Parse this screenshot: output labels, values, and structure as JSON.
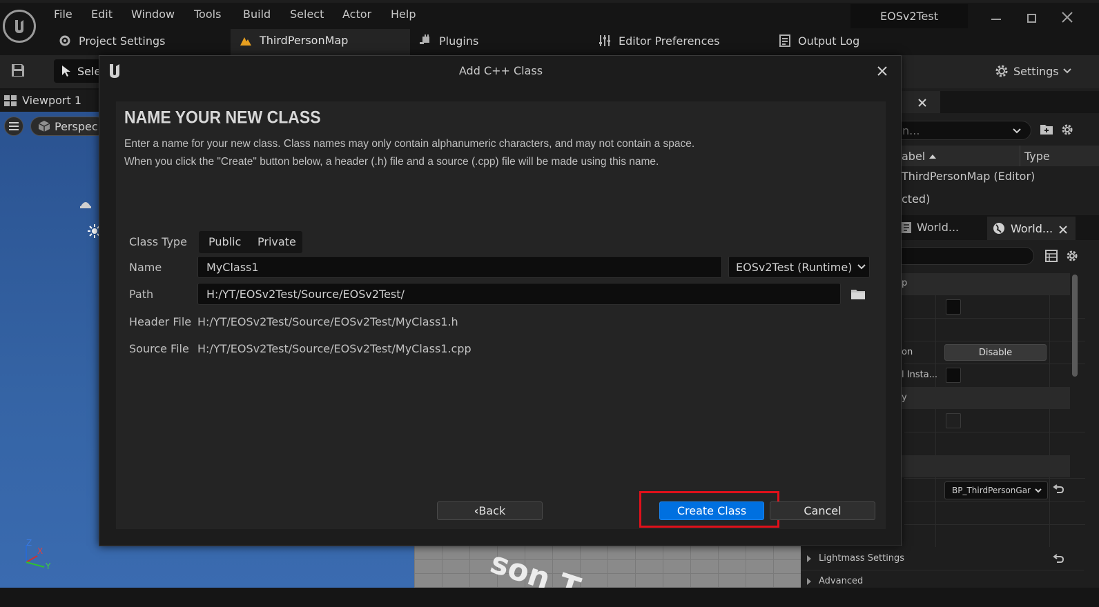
{
  "menubar": {
    "items": [
      "File",
      "Edit",
      "Window",
      "Tools",
      "Build",
      "Select",
      "Actor",
      "Help"
    ],
    "project_name": "EOSv2Test"
  },
  "tabs": {
    "project_settings": "Project Settings",
    "third_person_map": "ThirdPersonMap",
    "plugins": "Plugins",
    "editor_preferences": "Editor Preferences",
    "output_log": "Output Log"
  },
  "toolbar": {
    "select_label": "Sele",
    "settings_label": "Settings"
  },
  "viewport": {
    "tab_label": "Viewport 1",
    "perspective_label": "Perspec",
    "floor_text": "son T",
    "axis_x": "X",
    "axis_y": "Y",
    "axis_z": "Z"
  },
  "outliner": {
    "search_placeholder": "n...",
    "col_label": "abel",
    "col_type": "Type",
    "row1": "ThirdPersonMap (Editor)",
    "row2": "cted)"
  },
  "details": {
    "tab1": "World...",
    "tab2": "World...",
    "row_p": "p",
    "row_on": "on",
    "disable_btn": "Disable",
    "row_insta": "l Insta...",
    "row_y": "y",
    "gamemode_value": "BP_ThirdPersonGar",
    "lightmass": "Lightmass Settings",
    "advanced": "Advanced"
  },
  "dialog": {
    "title": "Add C++ Class",
    "heading": "NAME YOUR NEW CLASS",
    "desc_line1": "Enter a name for your new class. Class names may only contain alphanumeric characters, and may not contain a space.",
    "desc_line2": "When you click the \"Create\" button below, a header (.h) file and a source (.cpp) file will be made using this name.",
    "class_type_label": "Class Type",
    "public_label": "Public",
    "private_label": "Private",
    "name_label": "Name",
    "name_value": "MyClass1",
    "module_value": "EOSv2Test (Runtime)",
    "path_label": "Path",
    "path_value": "H:/YT/EOSv2Test/Source/EOSv2Test/",
    "header_label": "Header File",
    "header_value": "H:/YT/EOSv2Test/Source/EOSv2Test/MyClass1.h",
    "source_label": "Source File",
    "source_value": "H:/YT/EOSv2Test/Source/EOSv2Test/MyClass1.cpp",
    "back_label": "Back",
    "create_label": "Create Class",
    "cancel_label": "Cancel"
  },
  "colors": {
    "accent_blue": "#0070e0",
    "highlight_red": "#e0101a",
    "viewport_blue": "#2f5a94"
  }
}
